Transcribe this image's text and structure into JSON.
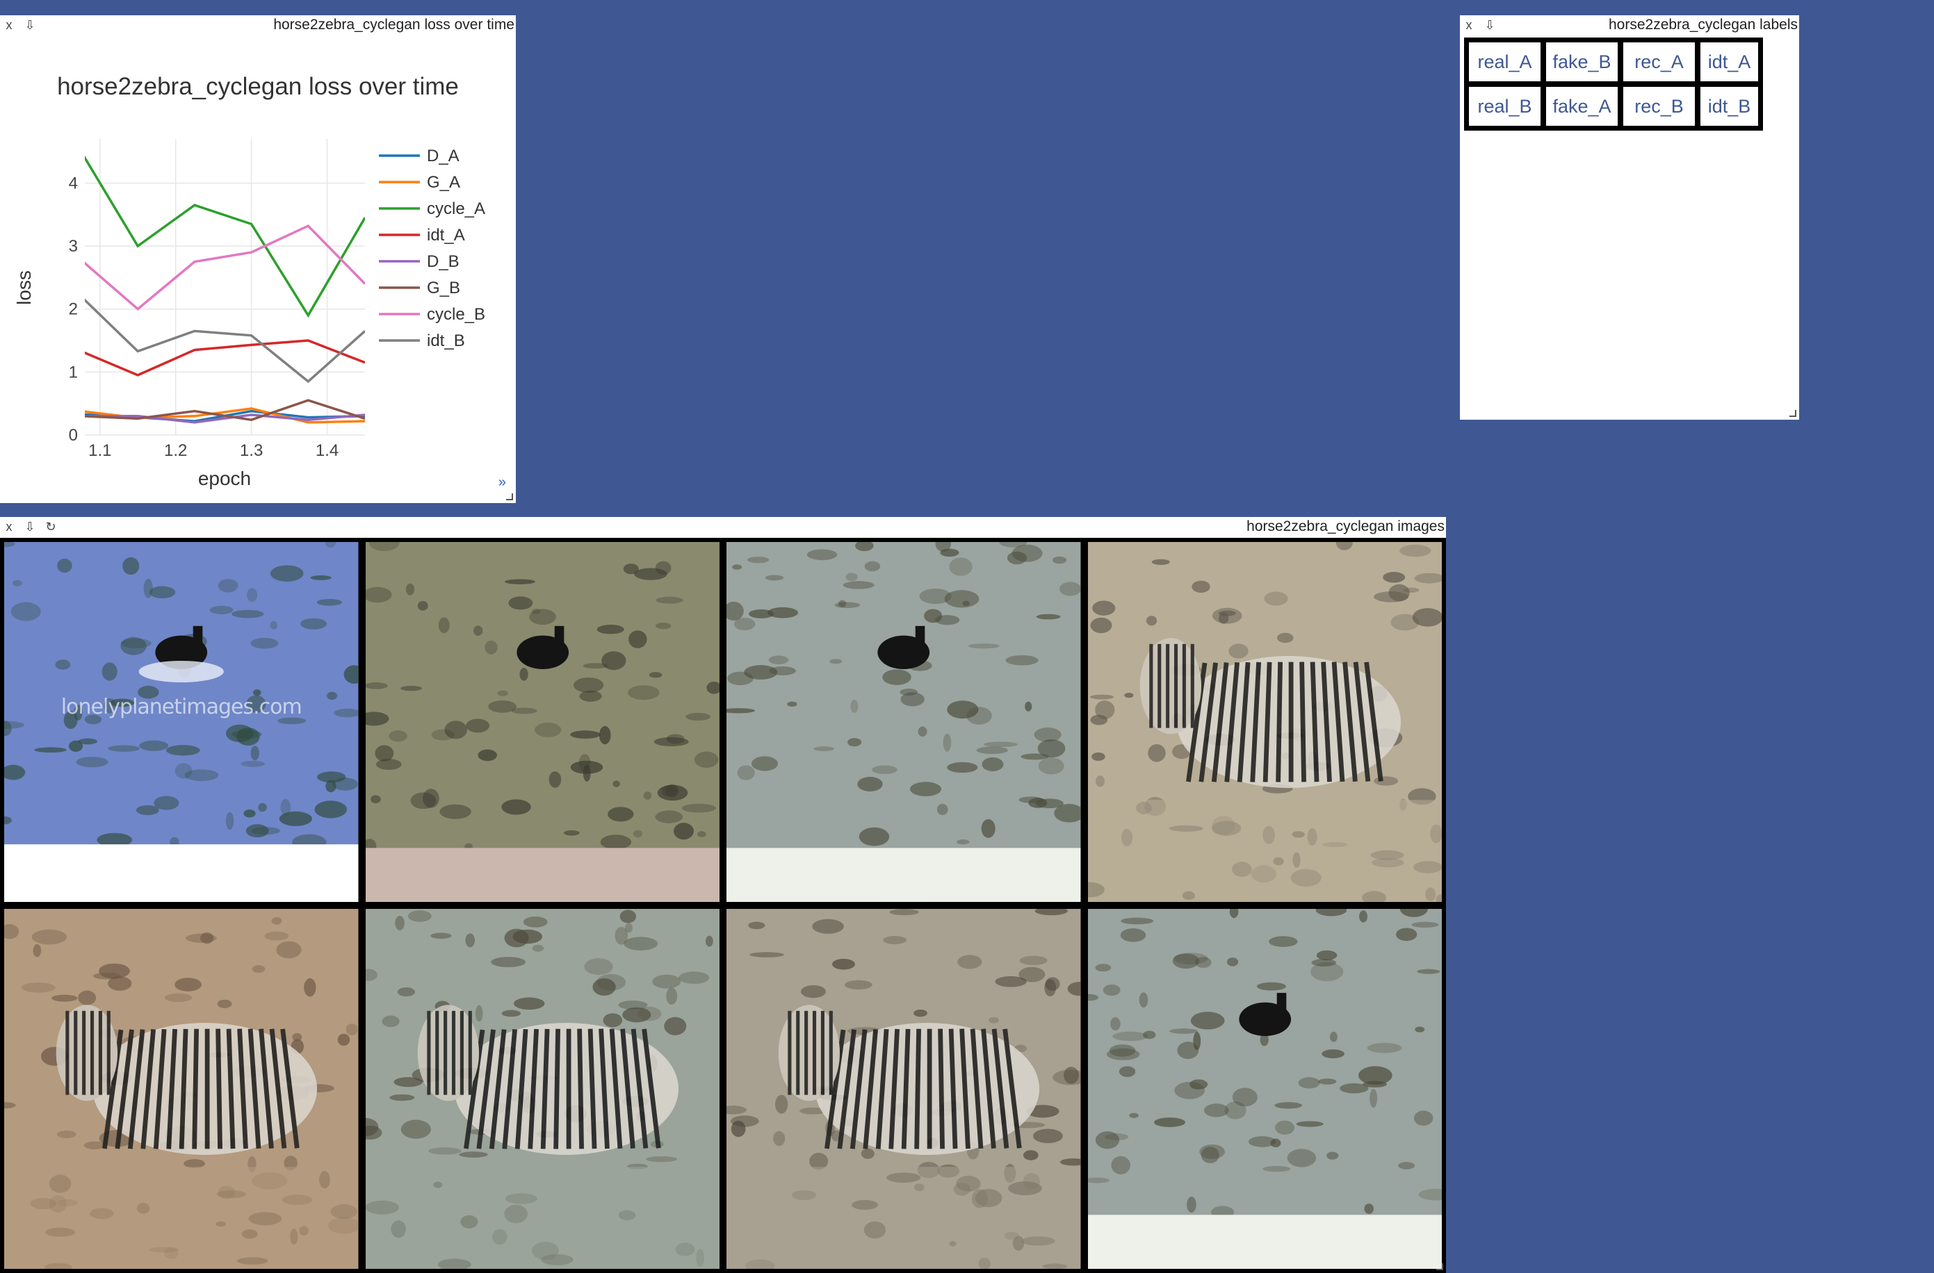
{
  "loss_window": {
    "title": "horse2zebra_cyclegan loss over time",
    "close_glyph": "x",
    "save_glyph": "⇩",
    "expand_glyph": "»"
  },
  "labels_window": {
    "title": "horse2zebra_cyclegan labels",
    "close_glyph": "x",
    "save_glyph": "⇩",
    "rows": [
      [
        "real_A",
        "fake_B",
        "rec_A",
        "idt_A"
      ],
      [
        "real_B",
        "fake_A",
        "rec_B",
        "idt_B"
      ]
    ]
  },
  "images_window": {
    "title": "horse2zebra_cyclegan images",
    "close_glyph": "x",
    "save_glyph": "⇩",
    "reset_glyph": "↻",
    "watermark": "lonelyplanetimages.com",
    "tiles": [
      {
        "name": "real_A",
        "scene": "horse-water"
      },
      {
        "name": "fake_B",
        "scene": "horse-dry"
      },
      {
        "name": "rec_A",
        "scene": "horse-water-faded"
      },
      {
        "name": "idt_A",
        "scene": "zebra-dry"
      },
      {
        "name": "real_B",
        "scene": "zebra-real"
      },
      {
        "name": "fake_A",
        "scene": "zebra-blurry"
      },
      {
        "name": "rec_B",
        "scene": "zebra-dark"
      },
      {
        "name": "idt_B",
        "scene": "horse-water-faded"
      }
    ]
  },
  "chart_data": {
    "type": "line",
    "title": "horse2zebra_cyclegan loss over time",
    "xlabel": "epoch",
    "ylabel": "loss",
    "xlim": [
      1.08,
      1.45
    ],
    "ylim": [
      0,
      4.7
    ],
    "xticks": [
      1.1,
      1.2,
      1.3,
      1.4
    ],
    "yticks": [
      0,
      1,
      2,
      3,
      4
    ],
    "grid": true,
    "legend": "right",
    "x": [
      1.075,
      1.15,
      1.225,
      1.3,
      1.375,
      1.45
    ],
    "series": [
      {
        "name": "D_A",
        "color": "#1f77b4",
        "values": [
          0.33,
          0.28,
          0.22,
          0.38,
          0.28,
          0.3
        ]
      },
      {
        "name": "G_A",
        "color": "#ff7f0e",
        "values": [
          0.38,
          0.27,
          0.3,
          0.42,
          0.2,
          0.22
        ]
      },
      {
        "name": "cycle_A",
        "color": "#2ca02c",
        "values": [
          4.5,
          3.0,
          3.65,
          3.35,
          1.9,
          3.45
        ]
      },
      {
        "name": "idt_A",
        "color": "#d62728",
        "values": [
          1.33,
          0.95,
          1.35,
          1.43,
          1.5,
          1.15
        ]
      },
      {
        "name": "D_B",
        "color": "#9467bd",
        "values": [
          0.3,
          0.3,
          0.2,
          0.32,
          0.24,
          0.32
        ]
      },
      {
        "name": "G_B",
        "color": "#8c564b",
        "values": [
          0.3,
          0.26,
          0.38,
          0.24,
          0.55,
          0.26
        ]
      },
      {
        "name": "cycle_B",
        "color": "#e377c2",
        "values": [
          2.78,
          2.0,
          2.75,
          2.9,
          3.32,
          2.4
        ]
      },
      {
        "name": "idt_B",
        "color": "#7f7f7f",
        "values": [
          2.2,
          1.33,
          1.65,
          1.58,
          0.85,
          1.65
        ]
      }
    ]
  }
}
